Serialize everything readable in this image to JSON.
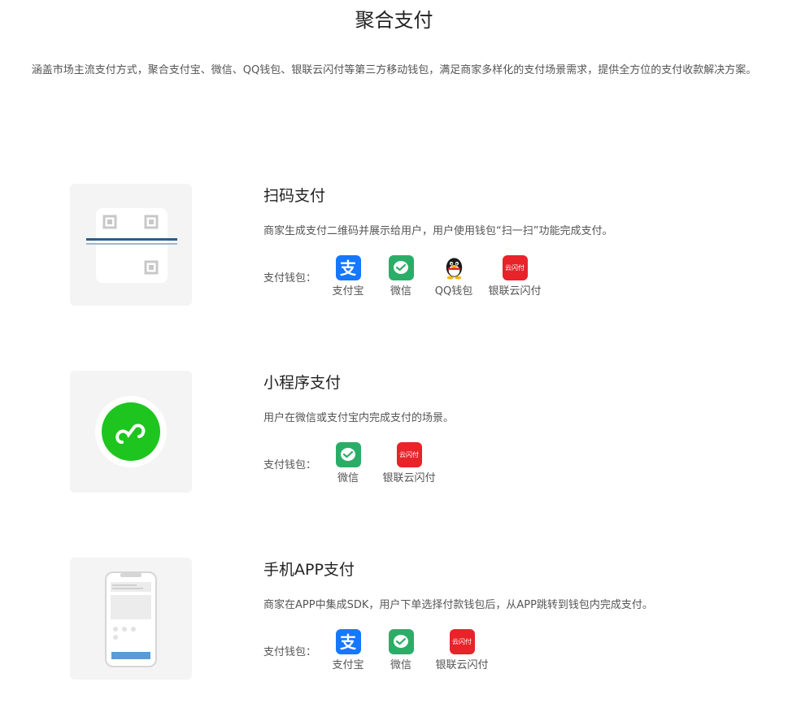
{
  "page": {
    "title": "聚合支付",
    "intro": "涵盖市场主流支付方式，聚合支付宝、微信、QQ钱包、银联云闪付等第三方移动钱包，满足商家多样化的支付场景需求，提供全方位的支付收款解决方案。"
  },
  "wallet_label": "支付钱包：",
  "methods": [
    {
      "title": "扫码支付",
      "desc": "商家生成支付二维码并展示给用户，用户使用钱包“扫一扫”功能完成支付。",
      "wallets": [
        "支付宝",
        "微信",
        "QQ钱包",
        "银联云闪付"
      ]
    },
    {
      "title": "小程序支付",
      "desc": "用户在微信或支付宝内完成支付的场景。",
      "wallets": [
        "微信",
        "银联云闪付"
      ]
    },
    {
      "title": "手机APP支付",
      "desc": "商家在APP中集成SDK，用户下单选择付款钱包后，从APP跳转到钱包内完成支付。",
      "wallets": [
        "支付宝",
        "微信",
        "银联云闪付"
      ]
    }
  ],
  "icons": {
    "alipay_glyph": "支",
    "unionpay_glyph": "云闪付"
  },
  "colors": {
    "alipay": "#1677ff",
    "wechat": "#2aae67",
    "unionpay": "#e8232a",
    "miniprogram": "#1ec51e"
  }
}
